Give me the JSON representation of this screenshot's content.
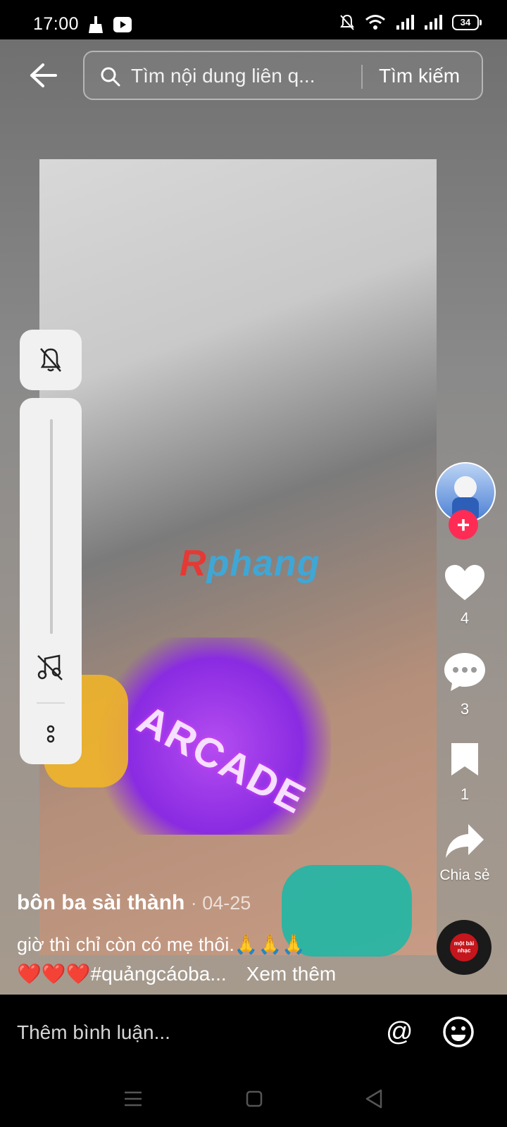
{
  "status_bar": {
    "time": "17:00",
    "left_icons": [
      "broom-icon",
      "video-app-icon"
    ],
    "right_icons": [
      "bell-off-icon",
      "wifi-icon",
      "signal-icon",
      "signal-icon"
    ],
    "battery": "34"
  },
  "header": {
    "back_icon": "arrow-left-icon",
    "search_placeholder": "Tìm nội dung liên q...",
    "search_button": "Tìm kiếm"
  },
  "side_panel": {
    "icons": [
      "bell-off-icon",
      "music-off-icon",
      "more-vertical-icon"
    ]
  },
  "video": {
    "watermark_first": "R",
    "watermark_rest": "phang",
    "sticker_text": "ARCADE"
  },
  "actions": {
    "likes": "4",
    "comments": "3",
    "saves": "1",
    "share_label": "Chia sẻ"
  },
  "music_disc_text": "một bài nhạc",
  "caption": {
    "author": "bôn ba sài thành",
    "date": "· 04-25",
    "line1": "giờ thì chỉ còn có mẹ thôi.🙏🙏🙏",
    "hearts": "❤️❤️❤️",
    "hashtag": "#quảngcáoba...",
    "see_more": "Xem thêm"
  },
  "comment_bar": {
    "placeholder": "Thêm bình luận...",
    "mention": "@"
  },
  "colors": {
    "accent": "#fe2c55",
    "background": "#000000"
  }
}
